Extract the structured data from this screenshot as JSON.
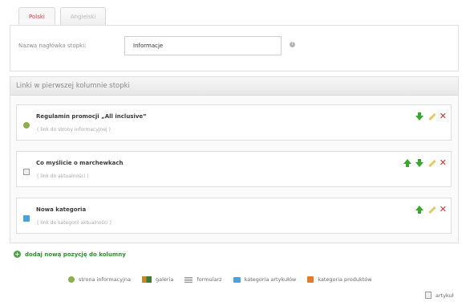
{
  "tabs": [
    {
      "label": "Polski",
      "active": true
    },
    {
      "label": "Angielski",
      "active": false
    }
  ],
  "header_form": {
    "label": "Nazwa nagłówka stopki:",
    "value": "Informacje",
    "help": "?"
  },
  "panel": {
    "title": "Linki w pierwszej kolumnie stopki",
    "items": [
      {
        "title": "Regulamin promocji „All inclusive”",
        "subtitle": "( link do strony informacyjnej )",
        "icon": "info-icon",
        "actions": [
          "move-down",
          "edit",
          "delete"
        ]
      },
      {
        "title": "Co myślicie o marchewkach",
        "subtitle": "( link do aktualności )",
        "icon": "article-icon",
        "actions": [
          "move-up",
          "move-down",
          "edit",
          "delete"
        ]
      },
      {
        "title": "Nowa kategoria",
        "subtitle": "( link do kategorii aktualności )",
        "icon": "category-icon",
        "actions": [
          "move-up",
          "edit",
          "delete"
        ]
      }
    ]
  },
  "add_link": "dodaj nową pozycję do kolumny",
  "legend": [
    {
      "label": "strona informacyjna",
      "icon": "info-icon"
    },
    {
      "label": "galeria",
      "icon": "gallery-icon"
    },
    {
      "label": "formularz",
      "icon": "form-icon"
    },
    {
      "label": "kategoria artykułów",
      "icon": "category-icon"
    },
    {
      "label": "kategoria produktów",
      "icon": "product-category-icon"
    },
    {
      "label": "artykuł",
      "icon": "article-icon"
    }
  ],
  "colors": {
    "accent_red": "#d43a3a",
    "action_green": "#37a72e",
    "delete_red": "#d9302c"
  }
}
